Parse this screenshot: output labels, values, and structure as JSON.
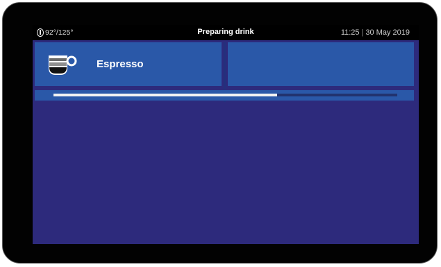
{
  "status_bar": {
    "temperature": "92°/125°",
    "title": "Preparing drink",
    "time": "11:25",
    "date": "30 May 2019"
  },
  "drink": {
    "name": "Espresso",
    "icon": "coffee-cup-icon"
  },
  "progress": {
    "percent": 65
  },
  "colors": {
    "screen_background": "#2d2a7c",
    "tile_background": "#2a58a8",
    "status_bar_background": "#000000",
    "progress_fill": "#f2f2f2"
  }
}
